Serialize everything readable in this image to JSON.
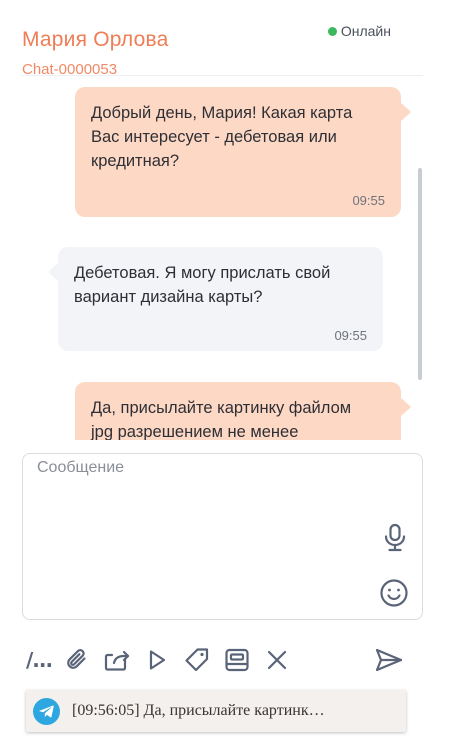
{
  "header": {
    "contact_name": "Мария Орлова",
    "chat_id": "Chat-0000053",
    "status": "Онлайн"
  },
  "messages": [
    {
      "direction": "out",
      "text_lines": [
        "Добрый день, Мария! Какая карта",
        "Вас интересует - дебетовая или",
        "кредитная?"
      ],
      "time": "09:55"
    },
    {
      "direction": "in",
      "text_lines": [
        "Дебетовая. Я могу прислать свой",
        "вариант дизайна карты?"
      ],
      "time": "09:55"
    },
    {
      "direction": "out",
      "text_lines": [
        "Да, присылайте картинку файлом",
        "jpg разрешением не менее"
      ]
    }
  ],
  "composer": {
    "placeholder": "Сообщение",
    "value": ""
  },
  "toolbar": {
    "commands_label": "/..."
  },
  "notification": {
    "text": "[09:56:05] Да, присылайте картинк…"
  },
  "colors": {
    "accent": "#ef7d55",
    "outgoing_bubble": "#fdd8c5",
    "incoming_bubble": "#f2f4f8",
    "online": "#3cb95d",
    "telegram": "#2ea6df",
    "icon": "#5a6478"
  },
  "icons": [
    "mic-icon",
    "emoji-icon",
    "paperclip-icon",
    "forward-icon",
    "play-icon",
    "tag-icon",
    "template-icon",
    "close-icon",
    "send-icon",
    "telegram-icon"
  ]
}
